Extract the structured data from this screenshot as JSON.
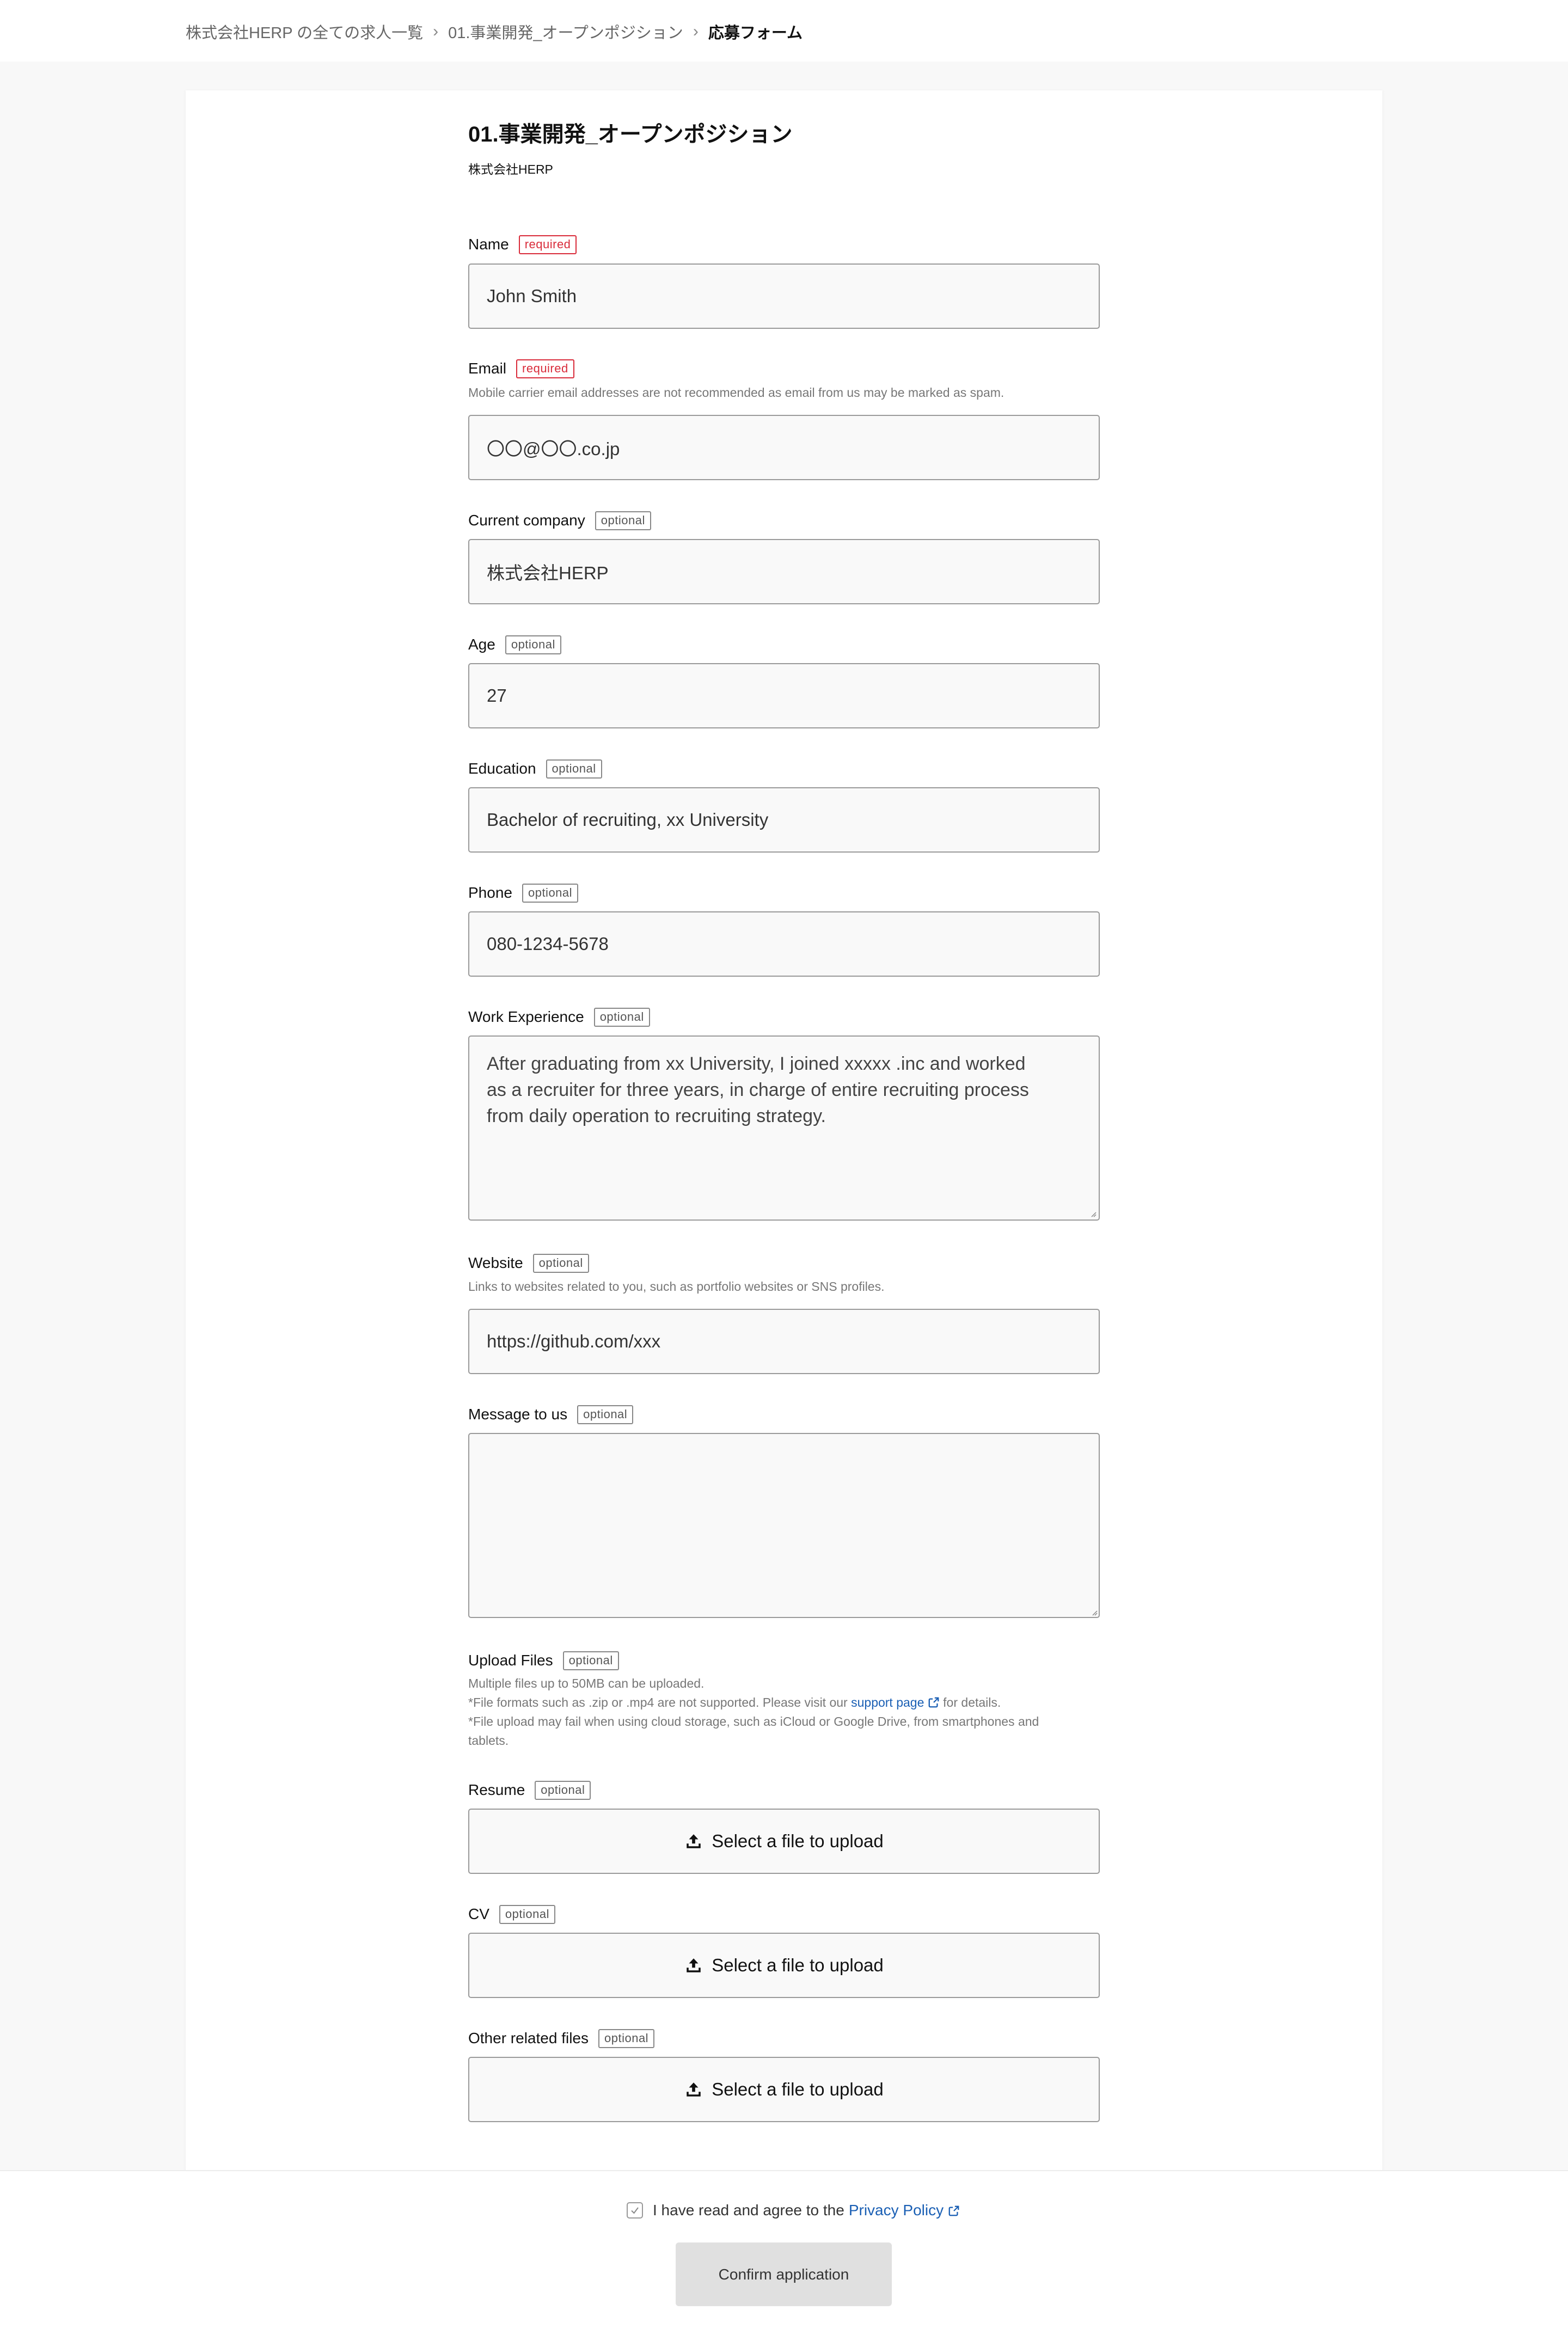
{
  "breadcrumb": {
    "items": [
      "株式会社HERP の全ての求人一覧",
      "01.事業開発_オープンポジション"
    ],
    "current": "応募フォーム"
  },
  "job": {
    "title": "01.事業開発_オープンポジション",
    "company": "株式会社HERP"
  },
  "tags": {
    "required": "required",
    "optional": "optional"
  },
  "fields": {
    "name": {
      "label": "Name",
      "value": "John Smith"
    },
    "email": {
      "label": "Email",
      "hint": "Mobile carrier email addresses are not recommended as email from us may be marked as spam.",
      "value": "〇〇@〇〇.co.jp"
    },
    "company": {
      "label": "Current company",
      "value": "株式会社HERP"
    },
    "age": {
      "label": "Age",
      "value": "27"
    },
    "education": {
      "label": "Education",
      "value": "Bachelor of recruiting, xx University"
    },
    "phone": {
      "label": "Phone",
      "value": "080-1234-5678"
    },
    "work": {
      "label": "Work Experience",
      "value_lines": [
        "After graduating from xx University, I joined xxxxx .inc and worked",
        "as a recruiter for three years, in charge of entire recruiting process",
        "from daily operation to recruiting strategy."
      ]
    },
    "website": {
      "label": "Website",
      "hint": "Links to websites related to you, such as portfolio websites or SNS profiles.",
      "value": "https://github.com/xxx"
    },
    "message": {
      "label": "Message to us",
      "value": ""
    }
  },
  "uploads": {
    "label": "Upload Files",
    "hint1": "Multiple files up to 50MB can be uploaded.",
    "hint2_pre": "*File formats such as .zip or .mp4 are not supported. Please visit our",
    "hint2_link": "support page",
    "hint2_post": "for details.",
    "hint3": "*File upload may fail when using cloud storage, such as iCloud or Google Drive, from smartphones and",
    "hint4": "tablets.",
    "button_label": "Select a file to upload",
    "resume_label": "Resume",
    "cv_label": "CV",
    "other_label": "Other related files"
  },
  "footer": {
    "agree_text": "I have read and agree to the",
    "privacy_link": "Privacy Policy",
    "confirm_label": "Confirm application"
  },
  "colors": {
    "required": "#d92b3a",
    "link": "#1a5fb4"
  },
  "icons": [
    "chevron-right-icon",
    "upload-icon",
    "external-link-icon",
    "checkmark-icon"
  ]
}
